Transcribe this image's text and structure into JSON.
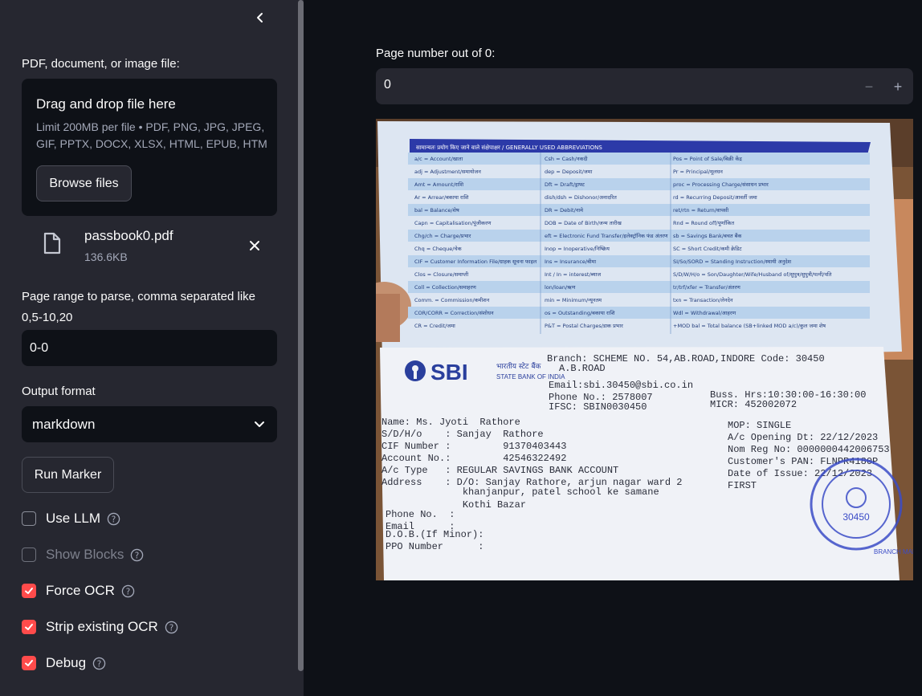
{
  "sidebar": {
    "upload_label": "PDF, document, or image file:",
    "dropzone": {
      "title": "Drag and drop file here",
      "limit": "Limit 200MB per file • PDF, PNG, JPG, JPEG, GIF, PPTX, DOCX, XLSX, HTML, EPUB, HTM",
      "browse_label": "Browse files"
    },
    "file": {
      "name": "passbook0.pdf",
      "size": "136.6KB"
    },
    "page_range_label": "Page range to parse, comma separated like 0,5-10,20",
    "page_range_value": "0-0",
    "output_format_label": "Output format",
    "output_format_value": "markdown",
    "run_label": "Run Marker",
    "checkboxes": [
      {
        "label": "Use LLM",
        "checked": false,
        "disabled": false
      },
      {
        "label": "Show Blocks",
        "checked": false,
        "disabled": true
      },
      {
        "label": "Force OCR",
        "checked": true,
        "disabled": false
      },
      {
        "label": "Strip existing OCR",
        "checked": true,
        "disabled": false
      },
      {
        "label": "Debug",
        "checked": true,
        "disabled": false
      }
    ]
  },
  "main": {
    "page_number_label": "Page number out of 0:",
    "page_number_value": "0",
    "minus_label": "−",
    "plus_label": "+"
  },
  "passbook": {
    "abbrev_header": "सामान्यतः प्रयोग किए जाने वाले संक्षेपाक्षर / GENERALLY USED ABBREVIATIONS",
    "abbrev_rows": [
      [
        "a/c = Account/खाता",
        "Csh = Cash/नकदी",
        "Pos = Point of Sale/बिक्री केंद्र"
      ],
      [
        "adj = Adjustment/समायोजन",
        "dep = Deposit/जमा",
        "Pr = Principal/मूलधन"
      ],
      [
        "Amt = Amount/राशि",
        "Dft = Draft/ड्राफ्ट",
        "proc = Processing Charge/संसाधन प्रभार"
      ],
      [
        "Ar = Arrear/बकाया राशि",
        "dish/dsh = Dishonor/अनादरित",
        "rd = Recurring Deposit/आवर्ती जमा"
      ],
      [
        "bal = Balance/शेष",
        "DR = Debit/नामे",
        "ret/rtn = Return/वापसी"
      ],
      [
        "Capn = Capitalisation/पूंजीकरण",
        "DOB = Date of Birth/जन्म तारीख",
        "Rnd = Round off/पूर्णांकित"
      ],
      [
        "Chg/ch = Charge/प्रभार",
        "eft = Electronic Fund Transfer/इलेक्ट्रॉनिक फंड अंतरण",
        "sb = Savings Bank/बचत बैंक"
      ],
      [
        "Chq = Cheque/चेक",
        "Inop = Inoperative/निष्क्रिय",
        "SC = Short Credit/कमी क्रेडिट"
      ],
      [
        "CIF = Customer Information File/ग्राहक सूचना फाइल",
        "Ins = Insurance/बीमा",
        "SI/So/SORD = Standing Instruction/स्थायी अनुदेश"
      ],
      [
        "Clos = Closure/समाप्ती",
        "Int / In = interest/ब्याज",
        "S/D/W/H/o = Son/Daughter/Wife/Husband of/सुपुत्र/सुपुत्री/पत्नी/पति"
      ],
      [
        "Coll = Collection/समाहरण",
        "lon/loan/ऋण",
        "tr/trf/xfer = Transfer/अंतरण"
      ],
      [
        "Comm. = Commission/कमीशन",
        "min = Minimum/न्यूनतम",
        "txn = Transaction/लेनदेन"
      ],
      [
        "COR/CORR = Correction/संशोधन",
        "os = Outstanding/बकाया राशि",
        "Wdl = Withdrawal/आहरण"
      ],
      [
        "CR = Credit/जमा",
        "P&T = Postal Charges/डाक प्रभार",
        "+MOD bal = Total balance (SB+linked MOD a/c)/कुल जमा शेष"
      ]
    ],
    "logo": "SBI",
    "bank_hindi": "भारतीय स्टेट बैंक",
    "bank_english": "STATE BANK OF INDIA",
    "branch": "Branch: SCHEME NO. 54,AB.ROAD,INDORE    Code: 30450",
    "branch2": "A.B.ROAD",
    "email": "Email:sbi.30450@sbi.co.in",
    "phone": "Phone No.: 2578007",
    "ifsc": "IFSC: SBIN0030450",
    "hours": "Buss. Hrs:10:30:00-16:30:00",
    "micr": "MICR: 452002072",
    "left_lines": [
      "Name: Ms. Jyoti  Rathore",
      "S/D/H/o    : Sanjay  Rathore",
      "CIF Number :         91370403443",
      "Account No.:         42546322492",
      "A/c Type   : REGULAR SAVINGS BANK ACCOUNT",
      "Address    : D/O: Sanjay Rathore, arjun nagar ward 2",
      "              khanjanpur, patel school ke samane",
      "              Kothi Bazar",
      "Phone No.  :",
      "Email      :",
      "D.O.B.(If Minor):",
      "PPO Number      :"
    ],
    "right_lines": [
      "MOP: SINGLE",
      "A/c Opening Dt: 22/12/2023",
      "Nom Reg No: 0000000442006753",
      "Customer's PAN: FLNPR4180P",
      "Date of Issue: 22/12/2023",
      "FIRST"
    ],
    "stamp_code": "30450",
    "branch_manager": "BRANCH MANAG"
  }
}
